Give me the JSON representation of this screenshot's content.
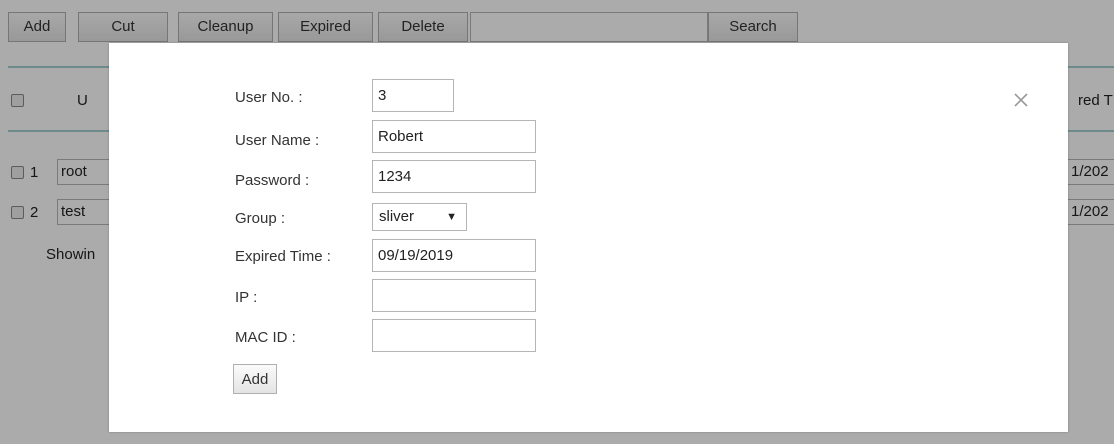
{
  "toolbar": {
    "buttons": [
      "Add",
      "Cut",
      "Cleanup",
      "Expired",
      "Delete"
    ],
    "search_value": "",
    "search_label": "Search"
  },
  "table": {
    "header_partial_left": "U",
    "header_partial_right": "red T",
    "rows": [
      {
        "no": "1",
        "name": "root",
        "expired_partial": "1/202"
      },
      {
        "no": "2",
        "name": "test",
        "expired_partial": "1/202"
      }
    ],
    "footer_partial": "Showin"
  },
  "modal": {
    "fields": {
      "user_no": {
        "label": "User No. :",
        "value": "3"
      },
      "user_name": {
        "label": "User Name :",
        "value": "Robert"
      },
      "password": {
        "label": "Password :",
        "value": "1234"
      },
      "group": {
        "label": "Group :",
        "value": "sliver"
      },
      "expired_time": {
        "label": "Expired Time :",
        "value": "09/19/2019"
      },
      "ip": {
        "label": "IP :",
        "value": ""
      },
      "mac_id": {
        "label": "MAC ID :",
        "value": ""
      }
    },
    "submit_label": "Add",
    "close_icon": "close-icon"
  },
  "colors": {
    "overlay": "#000000",
    "divider": "#a3d0cf",
    "modal_bg": "#ffffff"
  }
}
